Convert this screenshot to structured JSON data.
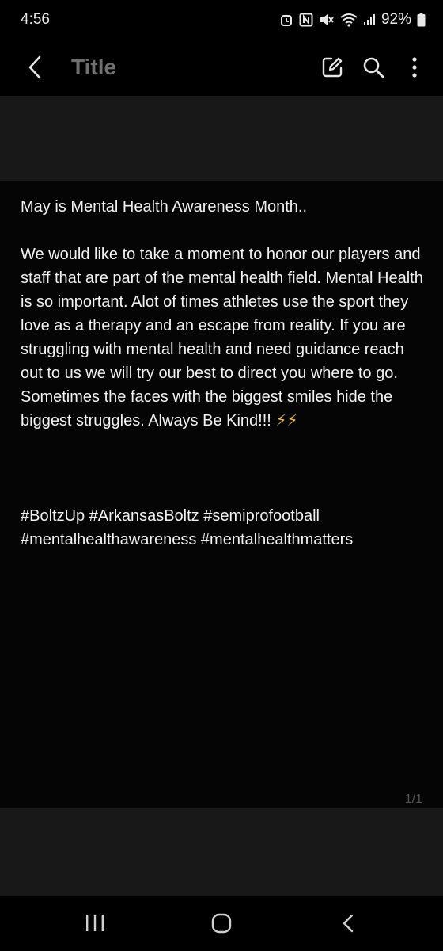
{
  "status": {
    "time": "4:56",
    "battery": "92%",
    "icons": [
      "alarm-icon",
      "nfc-icon",
      "mute-icon",
      "wifi-icon",
      "signal-icon",
      "battery-icon"
    ]
  },
  "app_bar": {
    "title_placeholder": "Title",
    "icons": [
      "back-icon",
      "edit-icon",
      "search-icon",
      "more-icon"
    ]
  },
  "note": {
    "line1": "May is Mental Health Awareness Month..",
    "paragraph": "We would like to take a moment to honor our players and staff that are part of the mental health field. Mental Health is so important. Alot of times athletes use the sport they love as a therapy and an escape from reality. If you are struggling with mental health and need guidance reach out to us we will try our best to direct you where to go. Sometimes the faces with the biggest smiles hide the biggest struggles. Always Be Kind!!!",
    "emoji": "⚡⚡",
    "hashtags_line1": "#BoltzUp #ArkansasBoltz #semiprofootball",
    "hashtags_line2": "#mentalhealthawareness #mentalhealthmatters"
  },
  "page_indicator": "1/1",
  "nav": {
    "icons": [
      "recent-apps-icon",
      "home-icon",
      "back-nav-icon"
    ]
  }
}
